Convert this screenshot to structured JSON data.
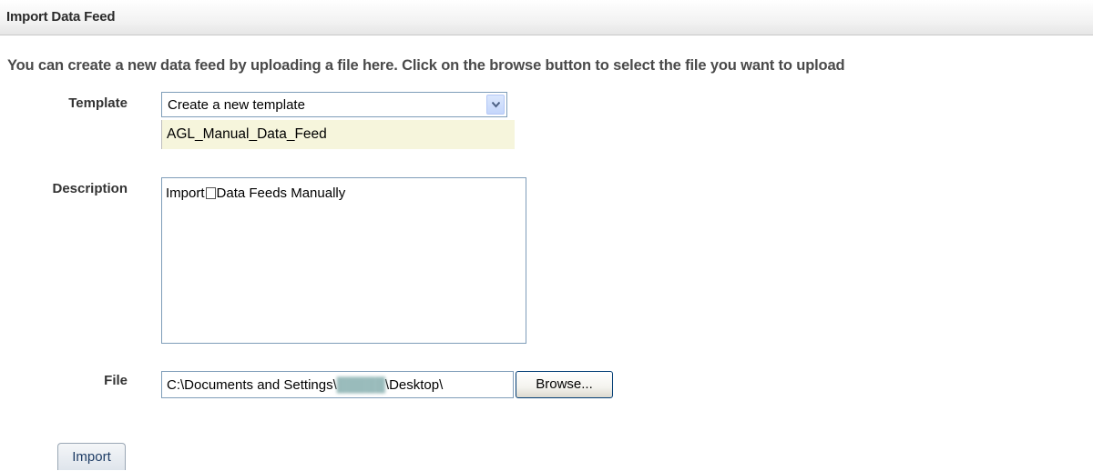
{
  "header": {
    "title": "Import Data Feed"
  },
  "intro_text": "You can create a new data feed by uploading a file here. Click on the browse button to select the file you want to upload",
  "form": {
    "template": {
      "label": "Template",
      "selected": "Create a new template",
      "highlighted_option": "AGL_Manual_Data_Feed"
    },
    "description": {
      "label": "Description",
      "value_before": "Import",
      "value_after": "Data Feeds Manually"
    },
    "file": {
      "label": "File",
      "path_prefix": "C:\\Documents and Settings\\",
      "path_redacted": "█████",
      "path_suffix": "\\Desktop\\",
      "browse_label": "Browse..."
    },
    "submit_label": "Import"
  }
}
